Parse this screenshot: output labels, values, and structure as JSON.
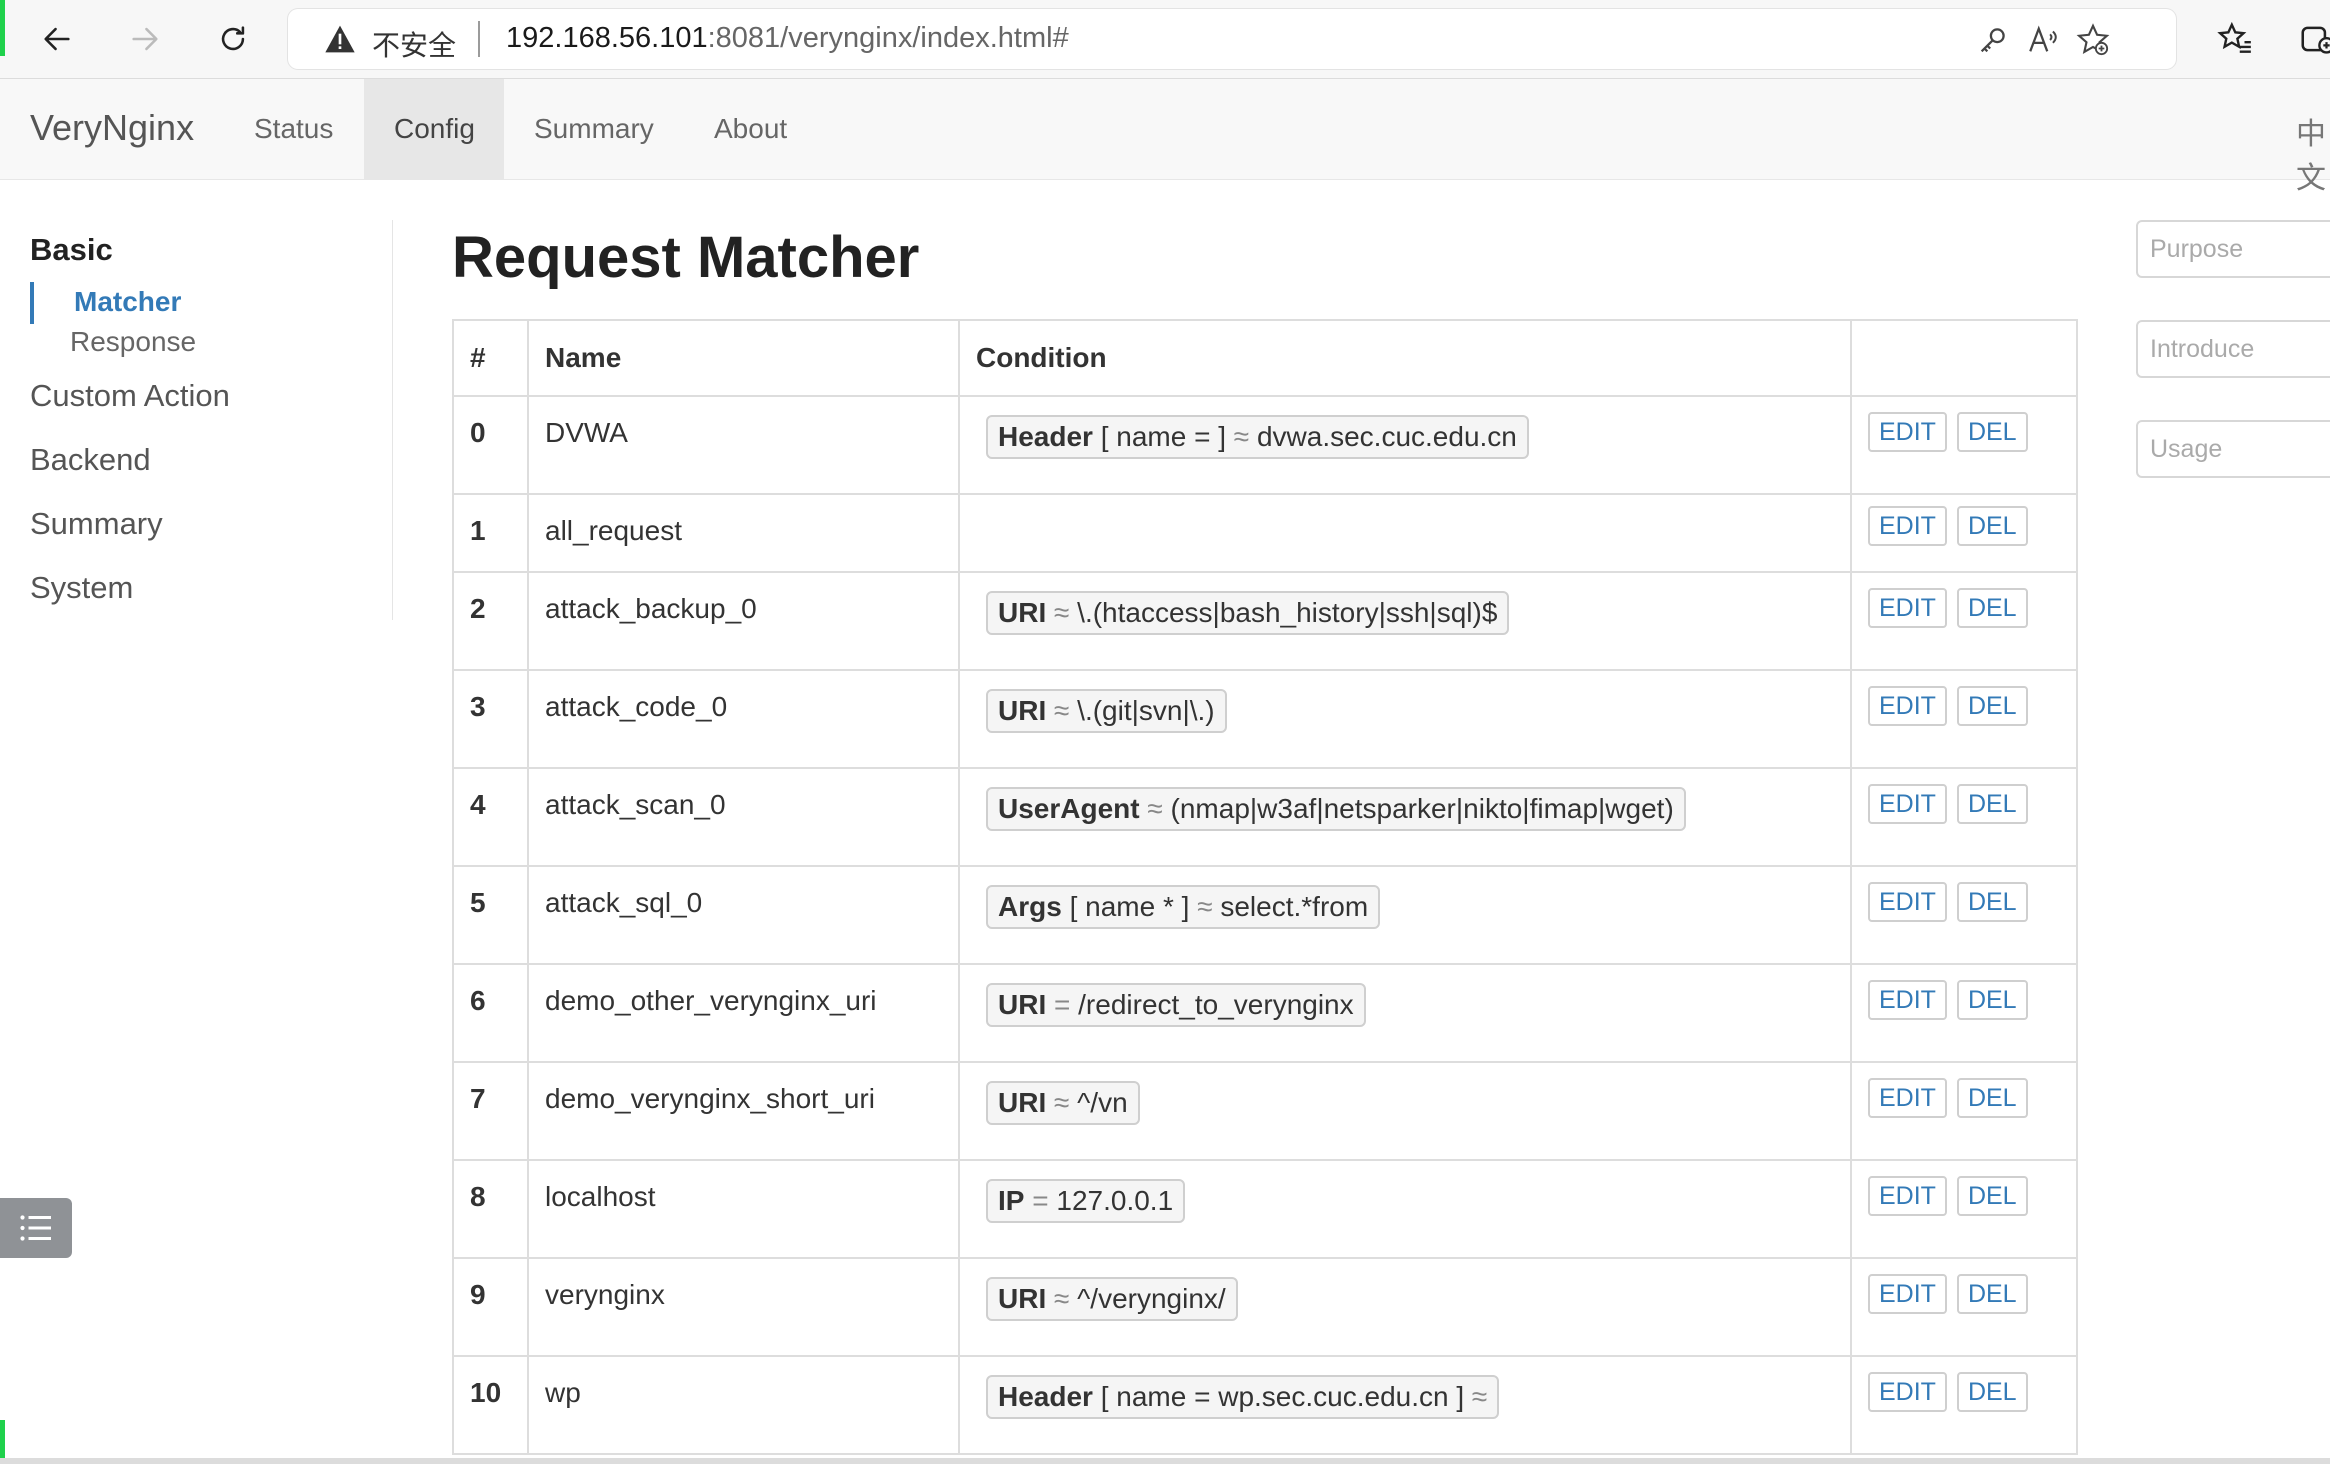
{
  "browser": {
    "security_label": "不安全",
    "url_host": "192.168.56.101",
    "url_rest": ":8081/verynginx/index.html#"
  },
  "navbar": {
    "brand": "VeryNginx",
    "links": [
      "Status",
      "Config",
      "Summary",
      "About"
    ],
    "active": "Config",
    "lang": "中文"
  },
  "sidebar": {
    "section": "Basic",
    "sub_items": [
      "Matcher",
      "Response"
    ],
    "active_sub": "Matcher",
    "items": [
      "Custom Action",
      "Backend",
      "Summary",
      "System"
    ]
  },
  "main": {
    "title": "Request Matcher",
    "columns": [
      "#",
      "Name",
      "Condition",
      ""
    ],
    "edit_label": "EDIT",
    "del_label": "DEL",
    "rows": [
      {
        "idx": "0",
        "name": "DVWA",
        "cond_key": "Header",
        "cond_arg": "[ name = ]",
        "cond_op": "≈",
        "cond_val": "dvwa.sec.cuc.edu.cn"
      },
      {
        "idx": "1",
        "name": "all_request",
        "cond_key": "",
        "cond_arg": "",
        "cond_op": "",
        "cond_val": ""
      },
      {
        "idx": "2",
        "name": "attack_backup_0",
        "cond_key": "URI",
        "cond_arg": "",
        "cond_op": "≈",
        "cond_val": "\\.(htaccess|bash_history|ssh|sql)$"
      },
      {
        "idx": "3",
        "name": "attack_code_0",
        "cond_key": "URI",
        "cond_arg": "",
        "cond_op": "≈",
        "cond_val": "\\.(git|svn|\\.)"
      },
      {
        "idx": "4",
        "name": "attack_scan_0",
        "cond_key": "UserAgent",
        "cond_arg": "",
        "cond_op": "≈",
        "cond_val": "(nmap|w3af|netsparker|nikto|fimap|wget)"
      },
      {
        "idx": "5",
        "name": "attack_sql_0",
        "cond_key": "Args",
        "cond_arg": "[ name * ]",
        "cond_op": "≈",
        "cond_val": "select.*from"
      },
      {
        "idx": "6",
        "name": "demo_other_verynginx_uri",
        "cond_key": "URI",
        "cond_arg": "",
        "cond_op": "=",
        "cond_val": "/redirect_to_verynginx"
      },
      {
        "idx": "7",
        "name": "demo_verynginx_short_uri",
        "cond_key": "URI",
        "cond_arg": "",
        "cond_op": "≈",
        "cond_val": "^/vn"
      },
      {
        "idx": "8",
        "name": "localhost",
        "cond_key": "IP",
        "cond_arg": "",
        "cond_op": "=",
        "cond_val": "127.0.0.1"
      },
      {
        "idx": "9",
        "name": "verynginx",
        "cond_key": "URI",
        "cond_arg": "",
        "cond_op": "≈",
        "cond_val": "^/verynginx/"
      },
      {
        "idx": "10",
        "name": "wp",
        "cond_key": "Header",
        "cond_arg": "[ name = wp.sec.cuc.edu.cn ]",
        "cond_op": "≈",
        "cond_val": ""
      }
    ]
  },
  "right_panel": {
    "placeholders": [
      "Purpose",
      "Introduce",
      "Usage"
    ]
  }
}
